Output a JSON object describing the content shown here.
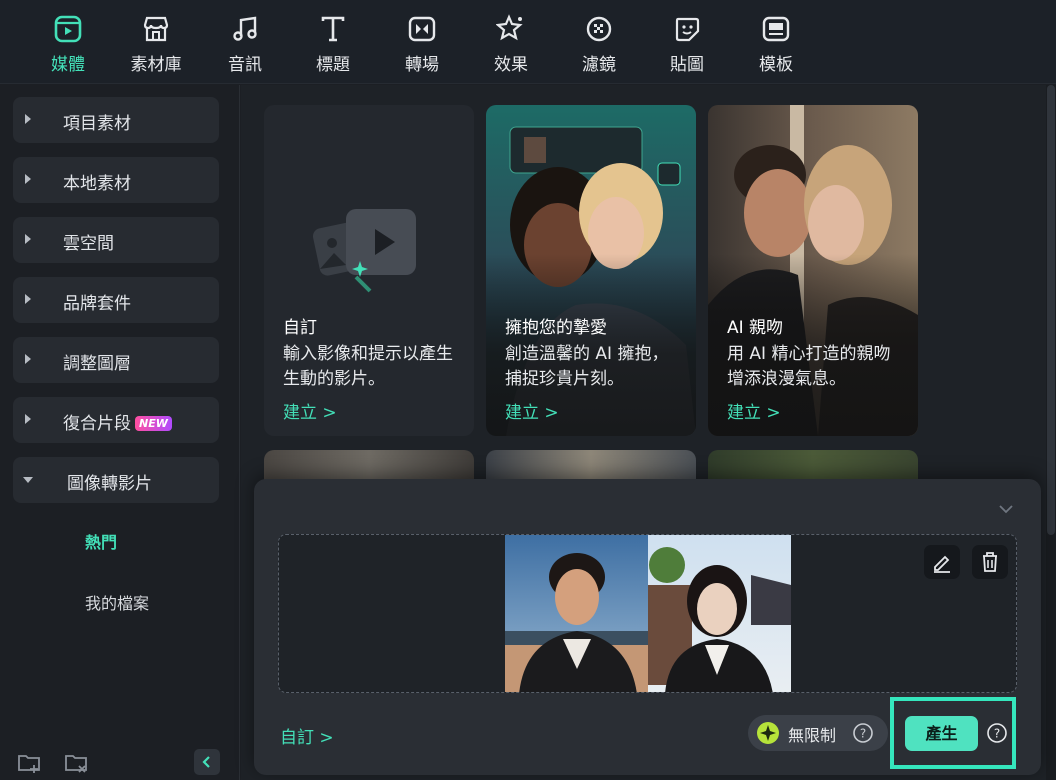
{
  "toolbar": {
    "items": [
      {
        "label": "媒體",
        "icon": "media-icon",
        "active": true
      },
      {
        "label": "素材庫",
        "icon": "store-icon"
      },
      {
        "label": "音訊",
        "icon": "music-note-icon"
      },
      {
        "label": "標題",
        "icon": "text-t-icon"
      },
      {
        "label": "轉場",
        "icon": "transition-icon"
      },
      {
        "label": "效果",
        "icon": "effects-star-icon"
      },
      {
        "label": "濾鏡",
        "icon": "filter-icon"
      },
      {
        "label": "貼圖",
        "icon": "sticker-icon"
      },
      {
        "label": "模板",
        "icon": "template-icon"
      }
    ]
  },
  "sidebar": {
    "items": [
      {
        "label": "項目素材"
      },
      {
        "label": "本地素材"
      },
      {
        "label": "雲空間"
      },
      {
        "label": "品牌套件"
      },
      {
        "label": "調整圖層"
      },
      {
        "label": "復合片段",
        "badge": "NEW"
      },
      {
        "label": "圖像轉影片",
        "expanded": true
      }
    ],
    "subitems": [
      {
        "label": "熱門",
        "active": true
      },
      {
        "label": "我的檔案"
      }
    ]
  },
  "cards": [
    {
      "title": "自訂",
      "desc": "輸入影像和提示以產生生動的影片。",
      "cta": "建立 >"
    },
    {
      "title": "擁抱您的摯愛",
      "desc": "創造溫馨的 AI 擁抱，捕捉珍貴片刻。",
      "cta": "建立 >"
    },
    {
      "title": "AI 親吻",
      "desc": "用 AI 精心打造的親吻增添浪漫氣息。",
      "cta": "建立 >"
    }
  ],
  "panel": {
    "custom_link": "自訂 >",
    "unlimited_label": "無限制",
    "generate_label": "產生",
    "help_symbol": "?"
  },
  "colors": {
    "accent": "#43e0b8",
    "highlight": "#35e6bd",
    "badge_gradient": [
      "#ff4fa0",
      "#b04bff"
    ]
  }
}
